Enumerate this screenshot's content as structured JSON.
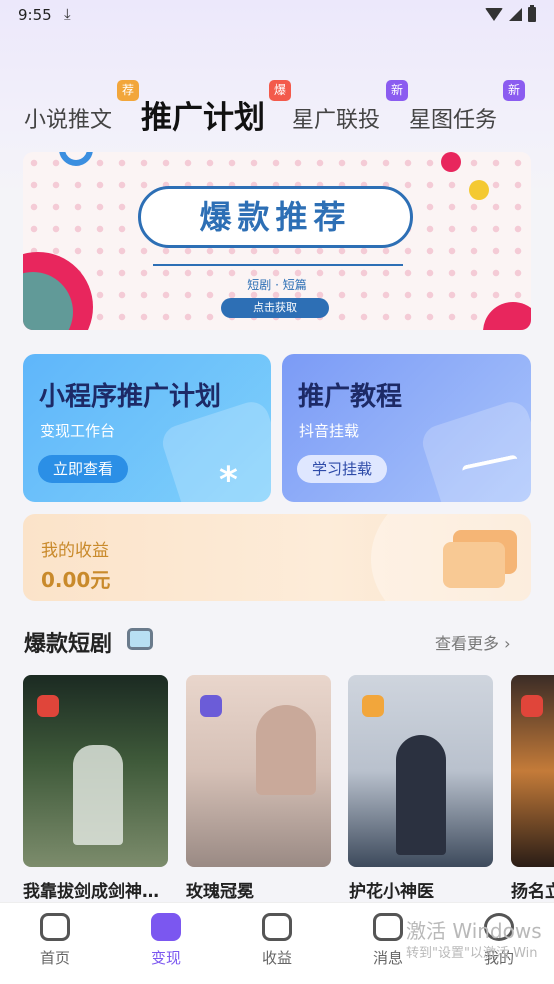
{
  "status_bar": {
    "time": "9:55"
  },
  "tabs": [
    {
      "label": "小说推文",
      "badge": "荐",
      "badge_color": "#f2a63b",
      "active": false
    },
    {
      "label": "推广计划",
      "badge": "爆",
      "badge_color": "#f35a4b",
      "active": true
    },
    {
      "label": "星广联投",
      "badge": "新",
      "badge_color": "#8b5cf0",
      "active": false
    },
    {
      "label": "星图任务",
      "badge": "新",
      "badge_color": "#8b5cf0",
      "active": false
    }
  ],
  "banner": {
    "title": "爆款推荐",
    "subtitle": "短剧 · 短篇",
    "button": "点击获取"
  },
  "cards": {
    "mini_program": {
      "title": "小程序推广计划",
      "subtitle": "变现工作台",
      "button": "立即查看"
    },
    "tutorial": {
      "title": "推广教程",
      "subtitle": "抖音挂载",
      "button": "学习挂载"
    }
  },
  "income": {
    "label": "我的收益",
    "value": "0.00元"
  },
  "hot_dramas": {
    "title": "爆款短剧",
    "more": "查看更多",
    "items": [
      {
        "name": "我靠拔剑成剑神…"
      },
      {
        "name": "玫瑰冠冕"
      },
      {
        "name": "护花小神医"
      },
      {
        "name": "扬名立"
      }
    ]
  },
  "bottom_nav": [
    {
      "label": "首页",
      "active": false
    },
    {
      "label": "变现",
      "active": true
    },
    {
      "label": "收益",
      "active": false
    },
    {
      "label": "消息",
      "active": false
    },
    {
      "label": "我的",
      "active": false
    }
  ],
  "watermark": {
    "line1": "激活 Windows",
    "line2": "转到\"设置\"以激活 Win"
  },
  "colors": {
    "accent": "#7b57f0",
    "banner_blue": "#2d6fb5",
    "income_text": "#c98a2b"
  }
}
